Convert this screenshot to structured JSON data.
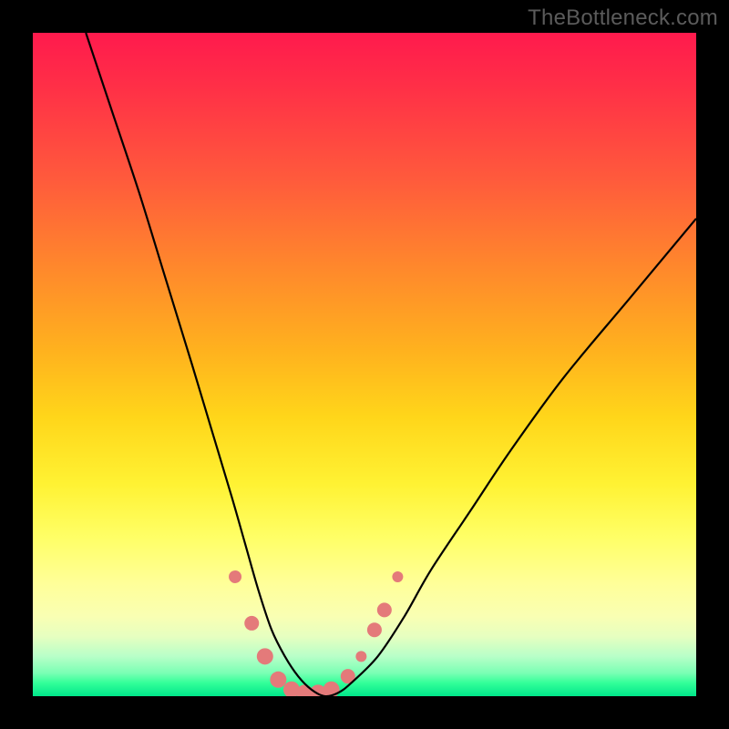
{
  "watermark": "TheBottleneck.com",
  "chart_data": {
    "type": "line",
    "title": "",
    "xlabel": "",
    "ylabel": "",
    "xlim": [
      0,
      100
    ],
    "ylim": [
      0,
      100
    ],
    "grid": false,
    "legend": false,
    "series": [
      {
        "name": "bottleneck-curve",
        "color": "#000000",
        "x": [
          8,
          12,
          16,
          20,
          24,
          27,
          30,
          32,
          34,
          36,
          38,
          40,
          42,
          44,
          46,
          48,
          52,
          56,
          60,
          66,
          72,
          80,
          90,
          100
        ],
        "y": [
          100,
          88,
          76,
          63,
          50,
          40,
          30,
          23,
          16,
          10,
          6,
          3,
          1,
          0,
          0.5,
          2,
          6,
          12,
          19,
          28,
          37,
          48,
          60,
          72
        ]
      }
    ],
    "markers": [
      {
        "x": 30.5,
        "y": 18,
        "r": 7,
        "color": "#e47a7a"
      },
      {
        "x": 33.0,
        "y": 11,
        "r": 8,
        "color": "#e47a7a"
      },
      {
        "x": 35.0,
        "y": 6,
        "r": 9,
        "color": "#e47a7a"
      },
      {
        "x": 37.0,
        "y": 2.5,
        "r": 9,
        "color": "#e47a7a"
      },
      {
        "x": 39.0,
        "y": 1,
        "r": 9,
        "color": "#e47a7a"
      },
      {
        "x": 41.0,
        "y": 0.5,
        "r": 9,
        "color": "#e47a7a"
      },
      {
        "x": 43.0,
        "y": 0.5,
        "r": 9,
        "color": "#e47a7a"
      },
      {
        "x": 45.0,
        "y": 1,
        "r": 9,
        "color": "#e47a7a"
      },
      {
        "x": 47.5,
        "y": 3,
        "r": 8,
        "color": "#e47a7a"
      },
      {
        "x": 49.5,
        "y": 6,
        "r": 6,
        "color": "#e47a7a"
      },
      {
        "x": 51.5,
        "y": 10,
        "r": 8,
        "color": "#e47a7a"
      },
      {
        "x": 53.0,
        "y": 13,
        "r": 8,
        "color": "#e47a7a"
      },
      {
        "x": 55.0,
        "y": 18,
        "r": 6,
        "color": "#e47a7a"
      }
    ]
  }
}
